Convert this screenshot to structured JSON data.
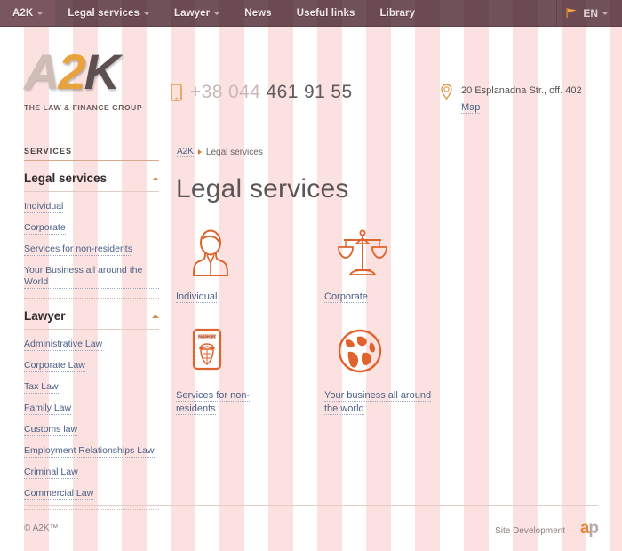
{
  "nav": {
    "items": [
      {
        "label": "A2K",
        "has_caret": true,
        "active": true
      },
      {
        "label": "Legal services",
        "has_caret": true,
        "active": false
      },
      {
        "label": "Lawyer",
        "has_caret": true,
        "active": false
      },
      {
        "label": "News",
        "has_caret": false,
        "active": false
      },
      {
        "label": "Useful links",
        "has_caret": false,
        "active": false
      },
      {
        "label": "Library",
        "has_caret": false,
        "active": false
      }
    ],
    "language": "EN",
    "language_icon": "flag-icon",
    "caret_icon": "chevron-down-icon"
  },
  "header": {
    "logo": {
      "part_a": "A",
      "part_2": "2",
      "part_k": "K",
      "tagline": "THE LAW & FINANCE GROUP"
    },
    "phone": {
      "icon": "mobile-phone-icon",
      "prefix": "+38 044",
      "number": " 461 91 55",
      "full": "+38 044 461 91 55"
    },
    "address": {
      "icon": "map-pin-icon",
      "line": "20 Esplanadna Str., off. 402",
      "map_link": "Map"
    }
  },
  "sidebar": {
    "caption": "SERVICES",
    "groups": [
      {
        "title": "Legal services",
        "collapse_icon": "collapse-arrow-icon",
        "links": [
          "Individual",
          "Corporate",
          "Services for non-residents",
          "Your Business all around the World"
        ]
      },
      {
        "title": "Lawyer",
        "collapse_icon": "collapse-arrow-icon",
        "links": [
          "Administrative Law",
          "Corporate Law",
          "Tax Law",
          "Family Law",
          "Customs law",
          "Employment Relationships Law",
          "Criminal Law",
          "Commercial Law"
        ]
      }
    ]
  },
  "breadcrumb": {
    "home": "A2K",
    "separator_icon": "arrow-right-icon",
    "current": "Legal services"
  },
  "main": {
    "title": "Legal services",
    "tiles": [
      {
        "label": "Individual",
        "icon": "person-bust-icon"
      },
      {
        "label": "Corporate",
        "icon": "scales-of-justice-icon"
      },
      {
        "label": "Services for non-residents",
        "icon": "passport-icon"
      },
      {
        "label": "Your business all around the world",
        "icon": "globe-icon"
      }
    ]
  },
  "footer": {
    "copyright": "© A2K™",
    "sitedev_label": "Site Development —",
    "sitedev_logo_a": "a",
    "sitedev_logo_p": "p"
  },
  "colors": {
    "nav_bg": "#6b4a53",
    "accent_orange": "#e0622c",
    "link_blue": "#4a5f86",
    "stripe_pink": "#fbe2e0",
    "logo_gold": "#e8a33d"
  }
}
